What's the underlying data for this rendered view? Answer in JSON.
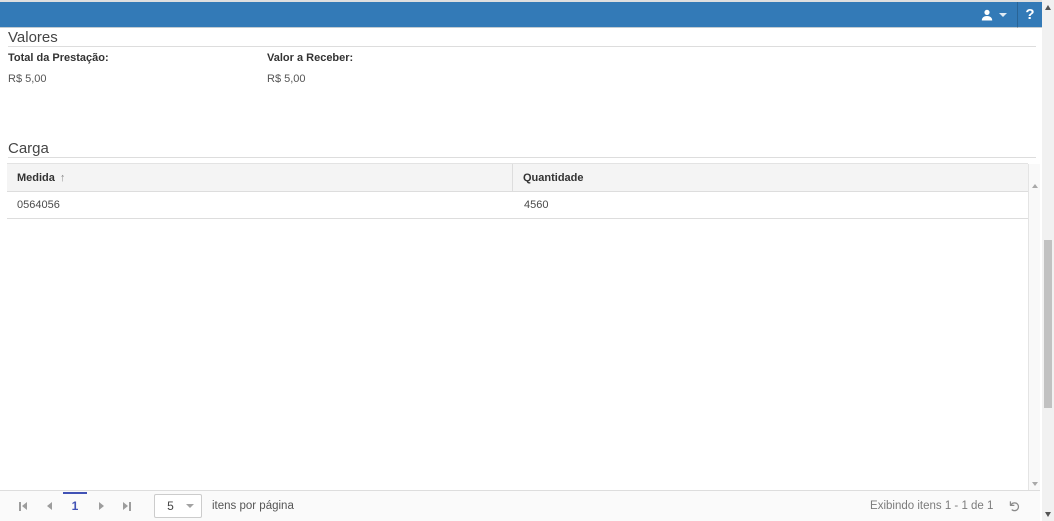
{
  "colors": {
    "header_blue": "#337ab7",
    "pager_active_blue": "#4152b5",
    "grid_header_bg": "#f4f4f4",
    "border_gray": "#dddddd"
  },
  "header": {
    "help_label": "?",
    "icons": [
      "user-icon",
      "chevron-down-icon",
      "help-icon"
    ]
  },
  "valores": {
    "title": "Valores",
    "fields": [
      {
        "label": "Total da Prestação:",
        "value": "R$ 5,00"
      },
      {
        "label": "Valor a Receber:",
        "value": "R$ 5,00"
      }
    ]
  },
  "carga": {
    "title": "Carga",
    "columns": [
      {
        "label": "Medida",
        "sort_indicator": "↑"
      },
      {
        "label": "Quantidade",
        "sort_indicator": ""
      }
    ],
    "rows": [
      [
        "0564056",
        "4560"
      ]
    ]
  },
  "pager": {
    "current_page": "1",
    "page_size": "5",
    "page_size_suffix": "itens por página",
    "info": "Exibindo itens 1 - 1 de 1",
    "refresh_icon": "↻"
  }
}
